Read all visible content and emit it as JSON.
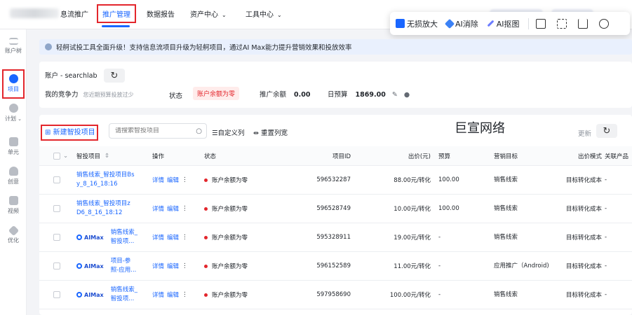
{
  "topnav": {
    "items": [
      {
        "label": "息流推广"
      },
      {
        "label": "推广管理"
      },
      {
        "label": "数据报告"
      },
      {
        "label": "资产中心"
      },
      {
        "label": "工具中心"
      }
    ]
  },
  "float_toolbar": {
    "items": [
      {
        "label": "无损放大"
      },
      {
        "label": "AI消除"
      },
      {
        "label": "AI抠图"
      }
    ]
  },
  "sidebar": {
    "items": [
      {
        "label": "账户树"
      },
      {
        "label": "项目"
      },
      {
        "label": "计划"
      },
      {
        "label": "单元"
      },
      {
        "label": "创意"
      },
      {
        "label": "视频"
      },
      {
        "label": "优化"
      }
    ]
  },
  "banner": {
    "text": "轻舸试投工具全面升级！支持信息流项目升级为轻舸项目，通过AI Max能力提升营销效果和投放效率"
  },
  "account": {
    "name": "账户 - searchlab",
    "competitiveness_label": "我的竞争力",
    "competitiveness_hint": "您近期预算投放过少",
    "status_label": "状态",
    "status_value": "账户余额为零",
    "balance_label": "推广余额",
    "balance_value": "0.00",
    "budget_label": "日预算",
    "budget_value": "1869.00"
  },
  "toolbar": {
    "new_button": "新建智投项目",
    "search_placeholder": "请搜索智投项目",
    "custom_columns": "自定义列",
    "reset_width": "重置列宽",
    "update": "更新",
    "watermark": "巨宣网络"
  },
  "table": {
    "headers": {
      "name": "智投项目",
      "ops": "操作",
      "status": "状态",
      "id": "项目ID",
      "bid": "出价(元)",
      "budget": "预算",
      "goal": "营销目标",
      "bid_mode": "出价模式",
      "related": "关联产品"
    },
    "ops_detail": "详情",
    "ops_edit": "编辑",
    "ops_more": "⋮",
    "aimax_label": "AIMax",
    "rows": [
      {
        "aimax": false,
        "name_line1": "销售线索_智投项目Bs",
        "name_line2": "y_8_16_18:16",
        "status": "账户余额为零",
        "id": "596532287",
        "bid": "88.00元/转化",
        "budget": "100.00",
        "goal_line1": "销售线索",
        "goal_line2": "",
        "bid_mode": "目标转化成本",
        "related": "-"
      },
      {
        "aimax": false,
        "name_line1": "销售线索_智投项目z",
        "name_line2": "D6_8_16_18:12",
        "status": "账户余额为零",
        "id": "596528749",
        "bid": "10.00元/转化",
        "budget": "100.00",
        "goal_line1": "销售线索",
        "goal_line2": "",
        "bid_mode": "目标转化成本",
        "related": "-"
      },
      {
        "aimax": true,
        "name_line1": "销售线索_",
        "name_line2": "智投项...",
        "status": "账户余额为零",
        "id": "595328911",
        "bid": "19.00元/转化",
        "budget": "-",
        "goal_line1": "销售线索",
        "goal_line2": "",
        "bid_mode": "目标转化成本",
        "related": "-"
      },
      {
        "aimax": true,
        "name_line1": "项目-参",
        "name_line2": "照-应用...",
        "status": "账户余额为零",
        "id": "596152589",
        "bid": "11.00元/转化",
        "budget": "-",
        "goal_line1": "应用推广（Andro",
        "goal_line2": "id)",
        "bid_mode": "目标转化成本",
        "related": "-"
      },
      {
        "aimax": true,
        "name_line1": "销售线索_",
        "name_line2": "智投项...",
        "status": "账户余额为零",
        "id": "597958690",
        "bid": "100.00元/转化",
        "budget": "-",
        "goal_line1": "销售线索",
        "goal_line2": "",
        "bid_mode": "目标转化成本",
        "related": "-"
      }
    ]
  },
  "colors": {
    "accent": "#1966ff",
    "danger": "#e3262c",
    "highlight_box": "#e3262c"
  }
}
